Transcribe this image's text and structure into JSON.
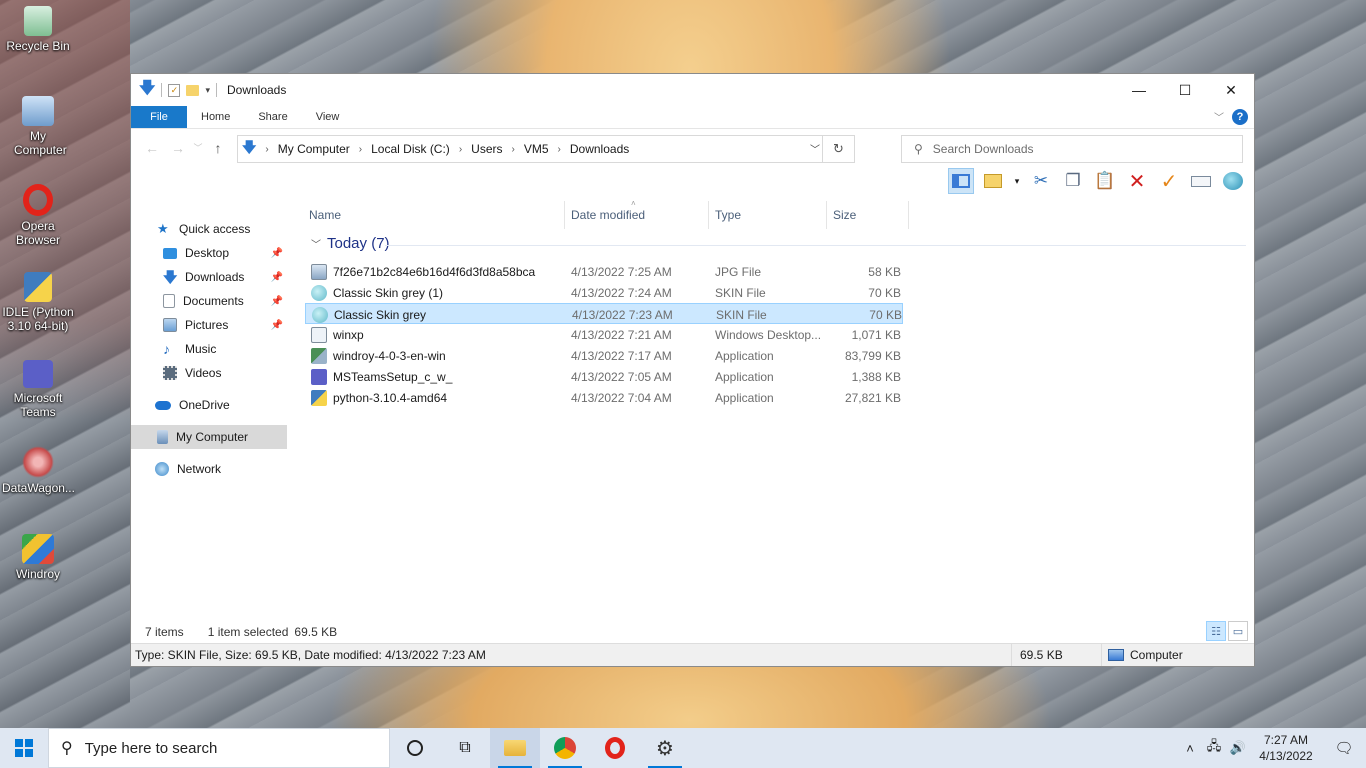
{
  "desktop": {
    "icons": [
      {
        "label": "Recycle Bin",
        "icon": "recycle-bin-icon",
        "color": "#9ccfa8"
      },
      {
        "label": "My Computer",
        "icon": "computer-icon",
        "color": "#8fb8e6"
      },
      {
        "label": "Opera Browser",
        "icon": "opera-icon",
        "color": "#e2231a"
      },
      {
        "label": "IDLE (Python 3.10 64-bit)",
        "icon": "python-icon",
        "color": "#3f7cbf"
      },
      {
        "label": "Microsoft Teams",
        "icon": "teams-icon",
        "color": "#5b5fc7"
      },
      {
        "label": "DataWagon...",
        "icon": "datawagon-icon",
        "color": "#c64b4b"
      },
      {
        "label": "Windroy",
        "icon": "windroy-icon",
        "color": "#3aa64a"
      }
    ]
  },
  "window": {
    "title": "Downloads",
    "controls": {
      "minimize": "—",
      "maximize": "☐",
      "close": "✕"
    },
    "ribbon": {
      "tabs": [
        "File",
        "Home",
        "Share",
        "View"
      ],
      "help": "?"
    },
    "address": {
      "crumbs": [
        "My Computer",
        "Local Disk (C:)",
        "Users",
        "VM5",
        "Downloads"
      ]
    },
    "search": {
      "placeholder": "Search Downloads"
    },
    "nav": {
      "items": [
        {
          "label": "Quick access",
          "icon": "star-icon",
          "color": "#1f74c8"
        },
        {
          "label": "Desktop",
          "icon": "desktop-icon",
          "color": "#2f8fdf",
          "pinned": true
        },
        {
          "label": "Downloads",
          "icon": "download-icon",
          "color": "#2b78d0",
          "pinned": true
        },
        {
          "label": "Documents",
          "icon": "document-icon",
          "color": "#9aa3ad",
          "pinned": true
        },
        {
          "label": "Pictures",
          "icon": "pictures-icon",
          "color": "#6a9fd4",
          "pinned": true
        },
        {
          "label": "Music",
          "icon": "music-icon",
          "color": "#2a6fc0"
        },
        {
          "label": "Videos",
          "icon": "video-icon",
          "color": "#5a6b7d"
        },
        {
          "label": "OneDrive",
          "icon": "onedrive-icon",
          "color": "#1e73d0"
        },
        {
          "label": "My Computer",
          "icon": "computer-icon",
          "color": "#6a8fb8",
          "selected": true
        },
        {
          "label": "Network",
          "icon": "network-icon",
          "color": "#3b87c9"
        }
      ]
    },
    "columns": {
      "name": "Name",
      "date": "Date modified",
      "type": "Type",
      "size": "Size"
    },
    "group": {
      "label": "Today (7)"
    },
    "files": [
      {
        "name": "7f26e71b2c84e6b16d4f6d3fd8a58bca",
        "date": "4/13/2022 7:25 AM",
        "type": "JPG File",
        "size": "58 KB",
        "icon": "image-file-icon",
        "color": "#8aa6c4"
      },
      {
        "name": "Classic Skin grey (1)",
        "date": "4/13/2022 7:24 AM",
        "type": "SKIN File",
        "size": "70 KB",
        "icon": "skin-file-icon",
        "color": "#5fb8c9"
      },
      {
        "name": "Classic Skin grey",
        "date": "4/13/2022 7:23 AM",
        "type": "SKIN File",
        "size": "70 KB",
        "icon": "skin-file-icon",
        "color": "#5fb8c9",
        "selected": true
      },
      {
        "name": "winxp",
        "date": "4/13/2022 7:21 AM",
        "type": "Windows Desktop...",
        "size": "1,071 KB",
        "icon": "theme-file-icon",
        "color": "#9eb3c8"
      },
      {
        "name": "windroy-4-0-3-en-win",
        "date": "4/13/2022 7:17 AM",
        "type": "Application",
        "size": "83,799 KB",
        "icon": "installer-icon",
        "color": "#4a8f56"
      },
      {
        "name": "MSTeamsSetup_c_w_",
        "date": "4/13/2022 7:05 AM",
        "type": "Application",
        "size": "1,388 KB",
        "icon": "teams-icon",
        "color": "#5b5fc7"
      },
      {
        "name": "python-3.10.4-amd64",
        "date": "4/13/2022 7:04 AM",
        "type": "Application",
        "size": "27,821 KB",
        "icon": "python-installer-icon",
        "color": "#3f7cbf"
      }
    ],
    "status": {
      "count": "7 items",
      "selection": "1 item selected",
      "sel_size": "69.5 KB"
    },
    "details": {
      "text": "Type: SKIN File, Size: 69.5 KB, Date modified: 4/13/2022 7:23 AM",
      "size": "69.5 KB",
      "location": "Computer"
    }
  },
  "taskbar": {
    "search_placeholder": "Type here to search",
    "clock_time": "7:27 AM",
    "clock_date": "4/13/2022"
  }
}
